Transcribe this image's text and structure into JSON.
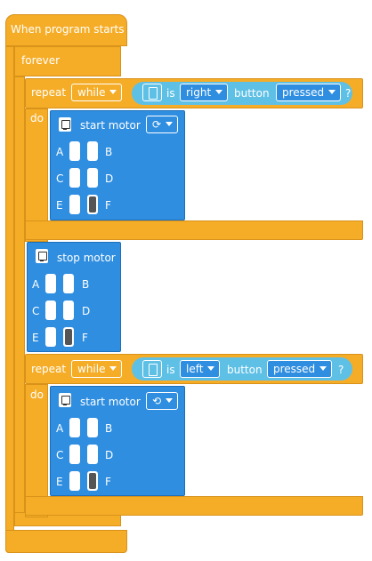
{
  "hat": {
    "label": "When program starts"
  },
  "forever": {
    "label": "forever"
  },
  "loop1": {
    "repeat_label": "repeat",
    "mode": "while",
    "is_label": "is",
    "side": "right",
    "button_label": "button",
    "state": "pressed",
    "q": "?",
    "do_label": "do",
    "motor": {
      "label": "start motor",
      "direction_glyph": "⟳",
      "ports": [
        "A",
        "B",
        "C",
        "D",
        "E",
        "F"
      ]
    }
  },
  "stop": {
    "label": "stop motor",
    "ports": [
      "A",
      "B",
      "C",
      "D",
      "E",
      "F"
    ]
  },
  "loop2": {
    "repeat_label": "repeat",
    "mode": "while",
    "is_label": "is",
    "side": "left",
    "button_label": "button",
    "state": "pressed",
    "q": "?",
    "do_label": "do",
    "motor": {
      "label": "start motor",
      "direction_glyph": "⟲",
      "ports": [
        "A",
        "B",
        "C",
        "D",
        "E",
        "F"
      ]
    }
  }
}
